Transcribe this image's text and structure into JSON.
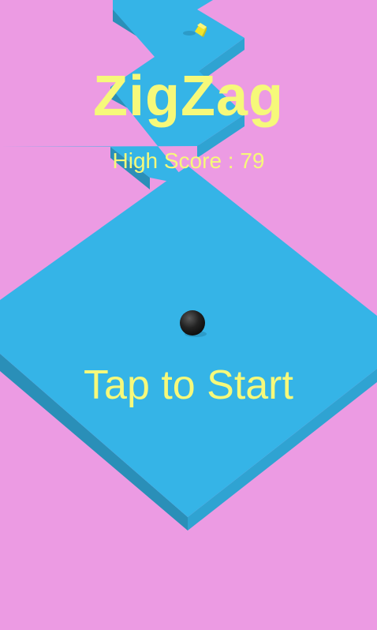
{
  "game": {
    "title": "ZigZag",
    "high_score_label": "High Score : 79",
    "start_prompt": "Tap to Start"
  },
  "colors": {
    "background": "#ec9be3",
    "platform_top": "#35b4e7",
    "platform_side_left": "#2a8fb8",
    "platform_side_right": "#2fa3d2",
    "text": "#f6f97a",
    "ball": "#1c1c1c",
    "gem": "#f2e52a"
  },
  "icons": {
    "ball": "ball-icon",
    "gem": "gem-icon"
  }
}
